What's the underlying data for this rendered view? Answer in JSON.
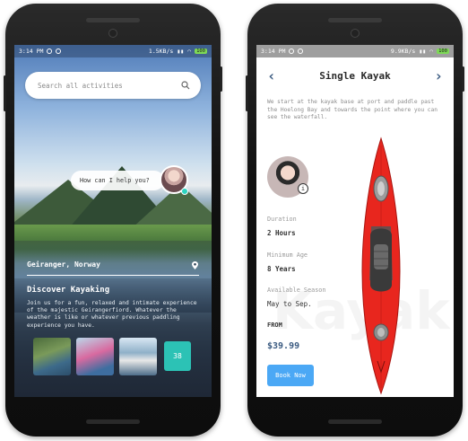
{
  "left_phone": {
    "status": {
      "time": "3:14 PM",
      "speed": "1.5KB/s",
      "battery": "100"
    },
    "search": {
      "placeholder": "Search all activities"
    },
    "chat": {
      "prompt": "How can I help you?"
    },
    "location": "Geiranger, Norway",
    "discover_title": "Discover Kayaking",
    "description": "Join us for a fun, relaxed and intimate experience of the majestic Geirangerfiord. Whatever the weather is like or whatever previous paddling experience you have.",
    "thumbnails": [
      "fjord-photo",
      "kayakers-photo",
      "boat-photo"
    ],
    "more_count": "38",
    "icons": {
      "search": "search-icon",
      "pin": "location-pin-icon"
    }
  },
  "right_phone": {
    "status": {
      "time": "3:14 PM",
      "speed": "9.9KB/s",
      "battery": "100"
    },
    "title": "Single Kayak",
    "intro": "We start at the kayak base at port and paddle past the Hoelong Bay and towards the point where you can see the waterfall.",
    "duration": {
      "label": "Duration",
      "value": "2 Hours"
    },
    "min_age": {
      "label": "Minimum Age",
      "value": "8 Years"
    },
    "season": {
      "label": "Available Season",
      "value": "May to Sep."
    },
    "from_label": "FROM",
    "price": "$39.99",
    "book_label": "Book Now",
    "watermark": "Kayak",
    "colors": {
      "accent": "#3a5a80",
      "button": "#4ba8f5",
      "kayak": "#e8261e",
      "teal": "#2cc2b5"
    }
  }
}
